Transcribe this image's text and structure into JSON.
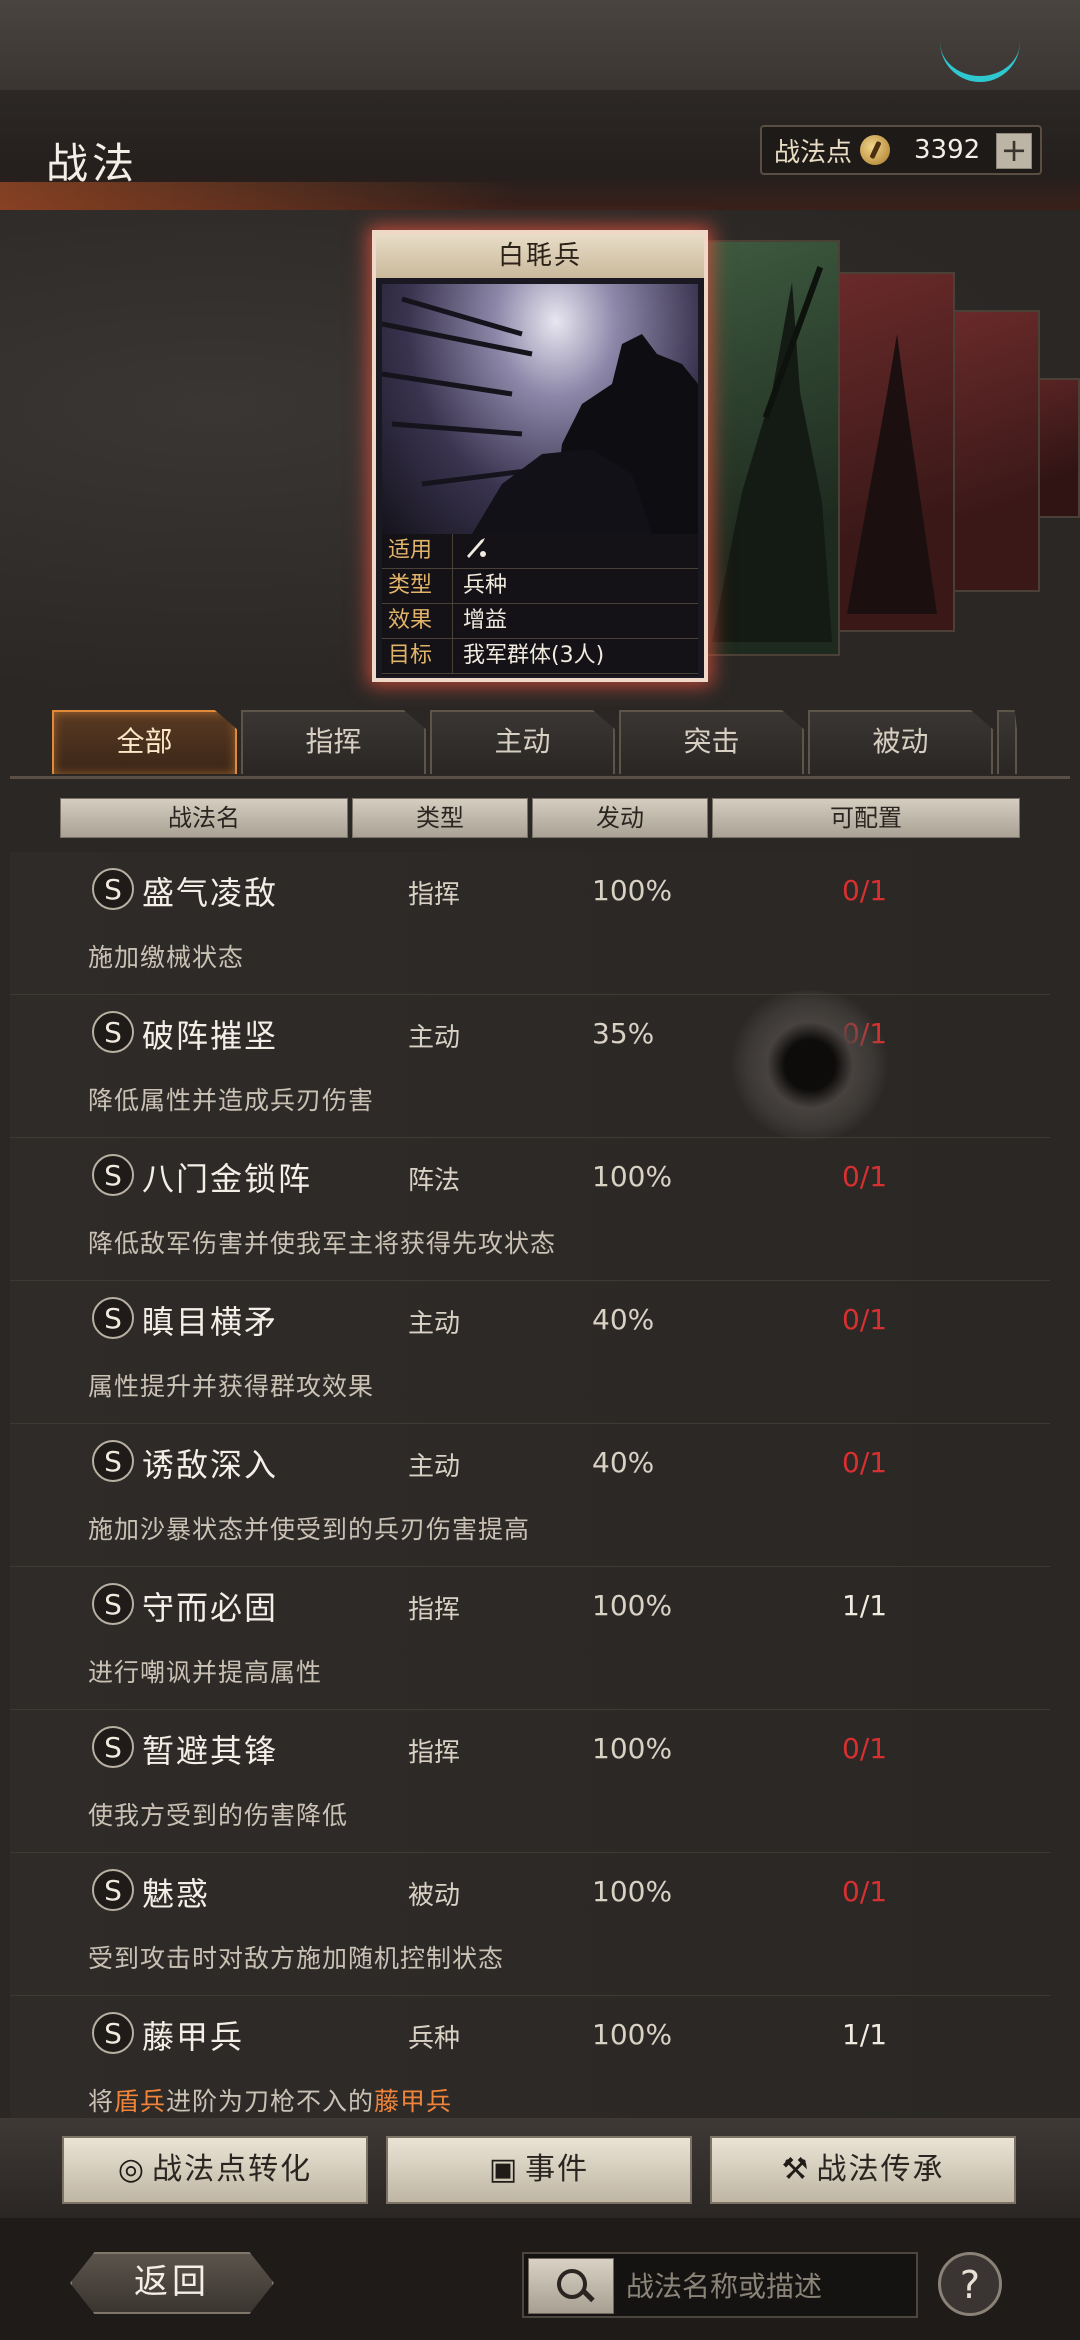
{
  "header": {
    "title": "战法",
    "points_label": "战法点",
    "points_value": "3392",
    "add_label": "+"
  },
  "card": {
    "name": "白毦兵",
    "rows": [
      {
        "key": "适用",
        "value": ""
      },
      {
        "key": "类型",
        "value": "兵种"
      },
      {
        "key": "效果",
        "value": "增益"
      },
      {
        "key": "目标",
        "value": "我军群体(3人)"
      }
    ]
  },
  "tabs": [
    "全部",
    "指挥",
    "主动",
    "突击",
    "被动"
  ],
  "columns": [
    "战法名",
    "类型",
    "发动",
    "可配置"
  ],
  "rows": [
    {
      "grade": "S",
      "name": "盛气凌敌",
      "type": "指挥",
      "rate": "100%",
      "config": "0/1",
      "config_color": "#d83030",
      "desc": "施加缴械状态"
    },
    {
      "grade": "S",
      "name": "破阵摧坚",
      "type": "主动",
      "rate": "35%",
      "config": "0/1",
      "config_color": "#d83030",
      "desc": "降低属性并造成兵刃伤害"
    },
    {
      "grade": "S",
      "name": "八门金锁阵",
      "type": "阵法",
      "rate": "100%",
      "config": "0/1",
      "config_color": "#d83030",
      "desc": "降低敌军伤害并使我军主将获得先攻状态"
    },
    {
      "grade": "S",
      "name": "瞋目横矛",
      "type": "主动",
      "rate": "40%",
      "config": "0/1",
      "config_color": "#d83030",
      "desc": "属性提升并获得群攻效果"
    },
    {
      "grade": "S",
      "name": "诱敌深入",
      "type": "主动",
      "rate": "40%",
      "config": "0/1",
      "config_color": "#d83030",
      "desc": "施加沙暴状态并使受到的兵刃伤害提高"
    },
    {
      "grade": "S",
      "name": "守而必固",
      "type": "指挥",
      "rate": "100%",
      "config": "1/1",
      "config_color": "#f0eadf",
      "desc": "进行嘲讽并提高属性"
    },
    {
      "grade": "S",
      "name": "暂避其锋",
      "type": "指挥",
      "rate": "100%",
      "config": "0/1",
      "config_color": "#d83030",
      "desc": "使我方受到的伤害降低"
    },
    {
      "grade": "S",
      "name": "魅惑",
      "type": "被动",
      "rate": "100%",
      "config": "0/1",
      "config_color": "#d83030",
      "desc": "受到攻击时对敌方施加随机控制状态"
    },
    {
      "grade": "S",
      "name": "藤甲兵",
      "type": "兵种",
      "rate": "100%",
      "config": "1/1",
      "config_color": "#f0eadf",
      "desc_parts": [
        "将",
        "盾兵",
        "进阶为刀枪不入的",
        "藤甲兵"
      ]
    }
  ],
  "bottom_buttons": [
    {
      "label": "战法点转化",
      "icon": "swirl-icon"
    },
    {
      "label": "事件",
      "icon": "scroll-icon"
    },
    {
      "label": "战法传承",
      "icon": "hammer-icon"
    }
  ],
  "footer": {
    "back_label": "返回",
    "search_placeholder": "战法名称或描述",
    "help_label": "?"
  }
}
